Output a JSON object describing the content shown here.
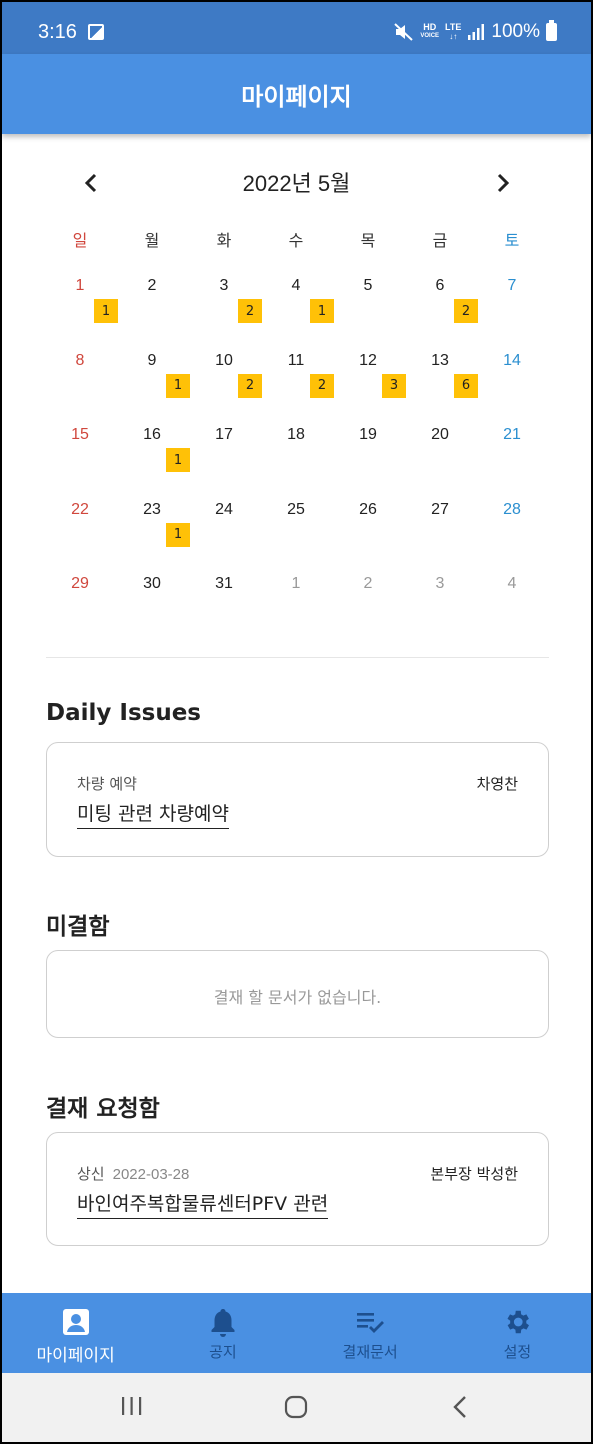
{
  "status": {
    "time": "3:16",
    "network": "HD",
    "network_sub": "LTE",
    "battery": "100%"
  },
  "app": {
    "title": "마이페이지"
  },
  "calendar": {
    "title": "2022년 5월",
    "weekdays": [
      "일",
      "월",
      "화",
      "수",
      "목",
      "금",
      "토"
    ],
    "weeks": [
      [
        {
          "d": "1",
          "b": "1"
        },
        {
          "d": "2",
          "b": ""
        },
        {
          "d": "3",
          "b": "2"
        },
        {
          "d": "4",
          "b": "1"
        },
        {
          "d": "5",
          "b": ""
        },
        {
          "d": "6",
          "b": "2"
        },
        {
          "d": "7",
          "b": ""
        }
      ],
      [
        {
          "d": "8",
          "b": ""
        },
        {
          "d": "9",
          "b": "1"
        },
        {
          "d": "10",
          "b": "2"
        },
        {
          "d": "11",
          "b": "2"
        },
        {
          "d": "12",
          "b": "3"
        },
        {
          "d": "13",
          "b": "6"
        },
        {
          "d": "14",
          "b": ""
        }
      ],
      [
        {
          "d": "15",
          "b": ""
        },
        {
          "d": "16",
          "b": "1"
        },
        {
          "d": "17",
          "b": ""
        },
        {
          "d": "18",
          "b": ""
        },
        {
          "d": "19",
          "b": ""
        },
        {
          "d": "20",
          "b": ""
        },
        {
          "d": "21",
          "b": ""
        }
      ],
      [
        {
          "d": "22",
          "b": ""
        },
        {
          "d": "23",
          "b": "1"
        },
        {
          "d": "24",
          "b": ""
        },
        {
          "d": "25",
          "b": ""
        },
        {
          "d": "26",
          "b": ""
        },
        {
          "d": "27",
          "b": ""
        },
        {
          "d": "28",
          "b": ""
        }
      ],
      [
        {
          "d": "29",
          "b": ""
        },
        {
          "d": "30",
          "b": ""
        },
        {
          "d": "31",
          "b": ""
        },
        {
          "d": "1",
          "b": "",
          "other": true
        },
        {
          "d": "2",
          "b": "",
          "other": true
        },
        {
          "d": "3",
          "b": "",
          "other": true
        },
        {
          "d": "4",
          "b": "",
          "other": true
        }
      ]
    ]
  },
  "daily": {
    "title": "Daily Issues",
    "category": "차량 예약",
    "assignee": "차영찬",
    "subject": "미팅 관련 차량예약"
  },
  "pending": {
    "title": "미결함",
    "empty": "결재 할 문서가 없습니다."
  },
  "requests": {
    "title": "결재 요청함",
    "category": "상신",
    "date": "2022-03-28",
    "assignee": "본부장 박성한",
    "subject": "바인여주복합물류센터PFV 관련"
  },
  "nav": {
    "items": [
      {
        "label": "마이페이지",
        "icon": "person-icon"
      },
      {
        "label": "공지",
        "icon": "bell-icon"
      },
      {
        "label": "결재문서",
        "icon": "checklist-icon"
      },
      {
        "label": "설정",
        "icon": "gear-icon"
      }
    ],
    "active_color": "#ffffff",
    "inactive_color": "#1d4f8e"
  },
  "colors": {
    "primary": "#4a90e2",
    "status": "#3e7ac5",
    "badge": "#ffc107",
    "sunday": "#d0473d",
    "saturday": "#2b8fd0"
  }
}
